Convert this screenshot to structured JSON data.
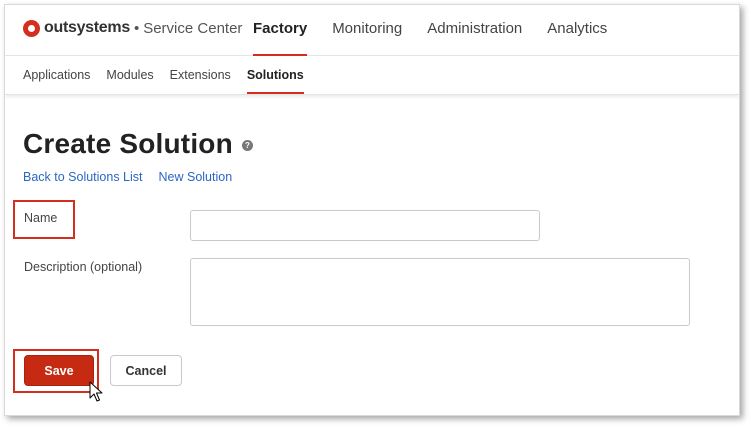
{
  "header": {
    "brand": "outsystems",
    "separator": "•",
    "product": "Service Center",
    "nav": [
      {
        "label": "Factory",
        "active": true
      },
      {
        "label": "Monitoring",
        "active": false
      },
      {
        "label": "Administration",
        "active": false
      },
      {
        "label": "Analytics",
        "active": false
      }
    ]
  },
  "subnav": [
    {
      "label": "Applications",
      "active": false
    },
    {
      "label": "Modules",
      "active": false
    },
    {
      "label": "Extensions",
      "active": false
    },
    {
      "label": "Solutions",
      "active": true
    }
  ],
  "page": {
    "title": "Create Solution",
    "help_icon": "question-icon",
    "links": {
      "back": "Back to Solutions List",
      "new": "New Solution"
    }
  },
  "form": {
    "name_label": "Name",
    "name_value": "",
    "description_label": "Description (optional)",
    "description_value": "",
    "save_label": "Save",
    "cancel_label": "Cancel"
  },
  "colors": {
    "accent": "#d32f1e",
    "save_button": "#c62a12",
    "link": "#2a67c4"
  }
}
